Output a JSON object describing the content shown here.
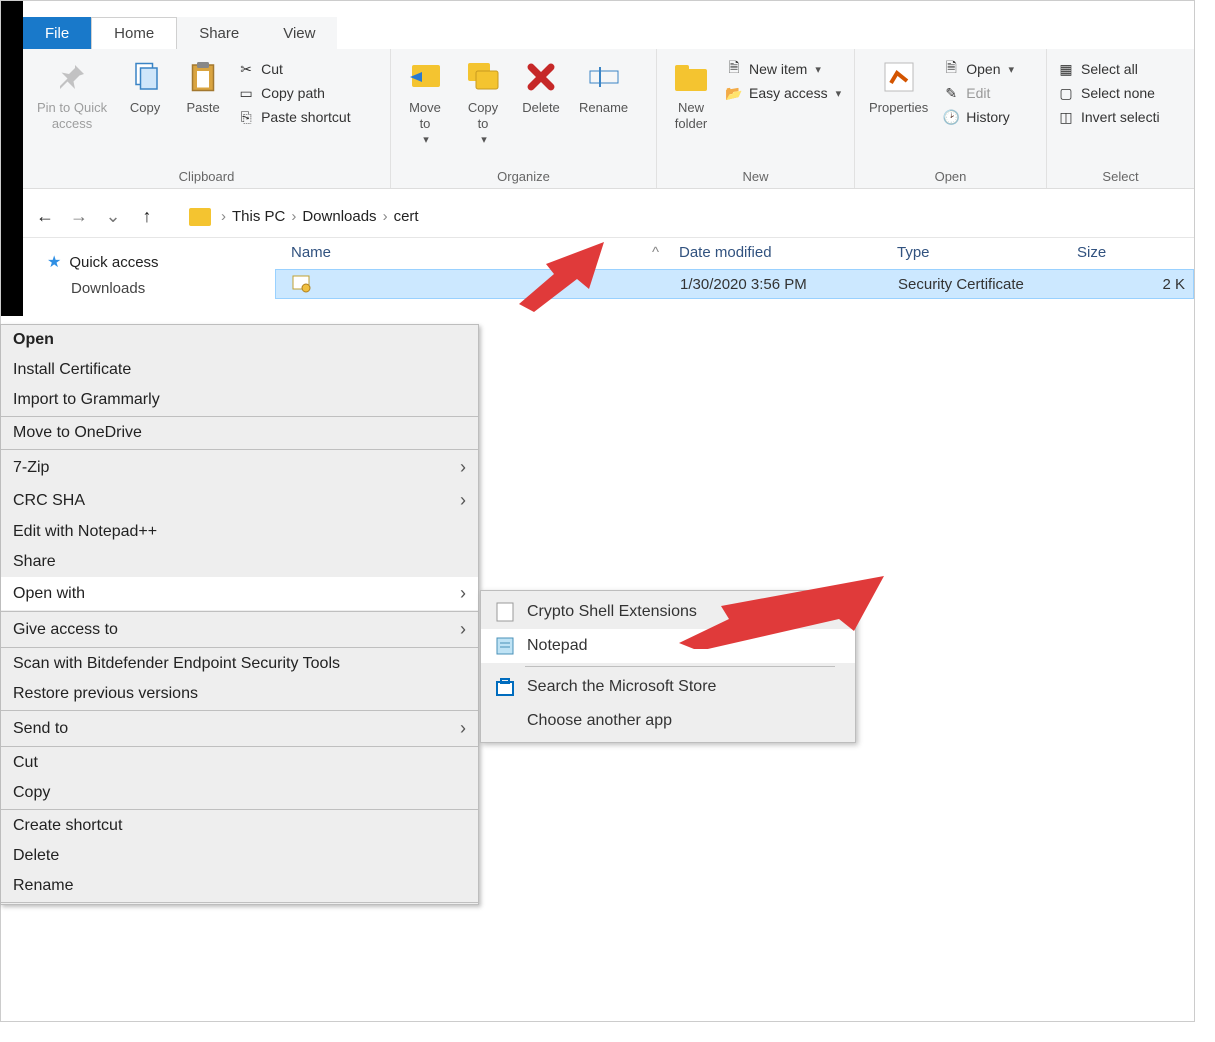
{
  "tabs": {
    "file": "File",
    "home": "Home",
    "share": "Share",
    "view": "View"
  },
  "ribbon": {
    "clipboard": {
      "label": "Clipboard",
      "pin": "Pin to Quick\naccess",
      "copy": "Copy",
      "paste": "Paste",
      "cut": "Cut",
      "copy_path": "Copy path",
      "paste_shortcut": "Paste shortcut"
    },
    "organize": {
      "label": "Organize",
      "move_to": "Move\nto",
      "copy_to": "Copy\nto",
      "delete": "Delete",
      "rename": "Rename"
    },
    "new": {
      "label": "New",
      "new_folder": "New\nfolder",
      "new_item": "New item",
      "easy_access": "Easy access"
    },
    "open": {
      "label": "Open",
      "properties": "Properties",
      "open": "Open",
      "edit": "Edit",
      "history": "History"
    },
    "select": {
      "label": "Select",
      "select_all": "Select all",
      "select_none": "Select none",
      "invert": "Invert selecti"
    }
  },
  "breadcrumb": {
    "pc": "This PC",
    "downloads": "Downloads",
    "cert": "cert"
  },
  "nav": {
    "quick_access": "Quick access",
    "downloads": "Downloads"
  },
  "columns": {
    "name": "Name",
    "date": "Date modified",
    "type": "Type",
    "size": "Size"
  },
  "file": {
    "name": "",
    "date": "1/30/2020 3:56 PM",
    "type": "Security Certificate",
    "size": "2 K"
  },
  "context_menu": [
    "Open",
    "Install Certificate",
    "Import to Grammarly",
    "Move to OneDrive",
    "7-Zip",
    "CRC SHA",
    "Edit with Notepad++",
    "Share",
    "Open with",
    "Give access to",
    "Scan with Bitdefender Endpoint Security Tools",
    "Restore previous versions",
    "Send to",
    "Cut",
    "Copy",
    "Create shortcut",
    "Delete",
    "Rename"
  ],
  "submenu": {
    "crypto": "Crypto Shell Extensions",
    "notepad": "Notepad",
    "store": "Search the Microsoft Store",
    "choose": "Choose another app"
  }
}
